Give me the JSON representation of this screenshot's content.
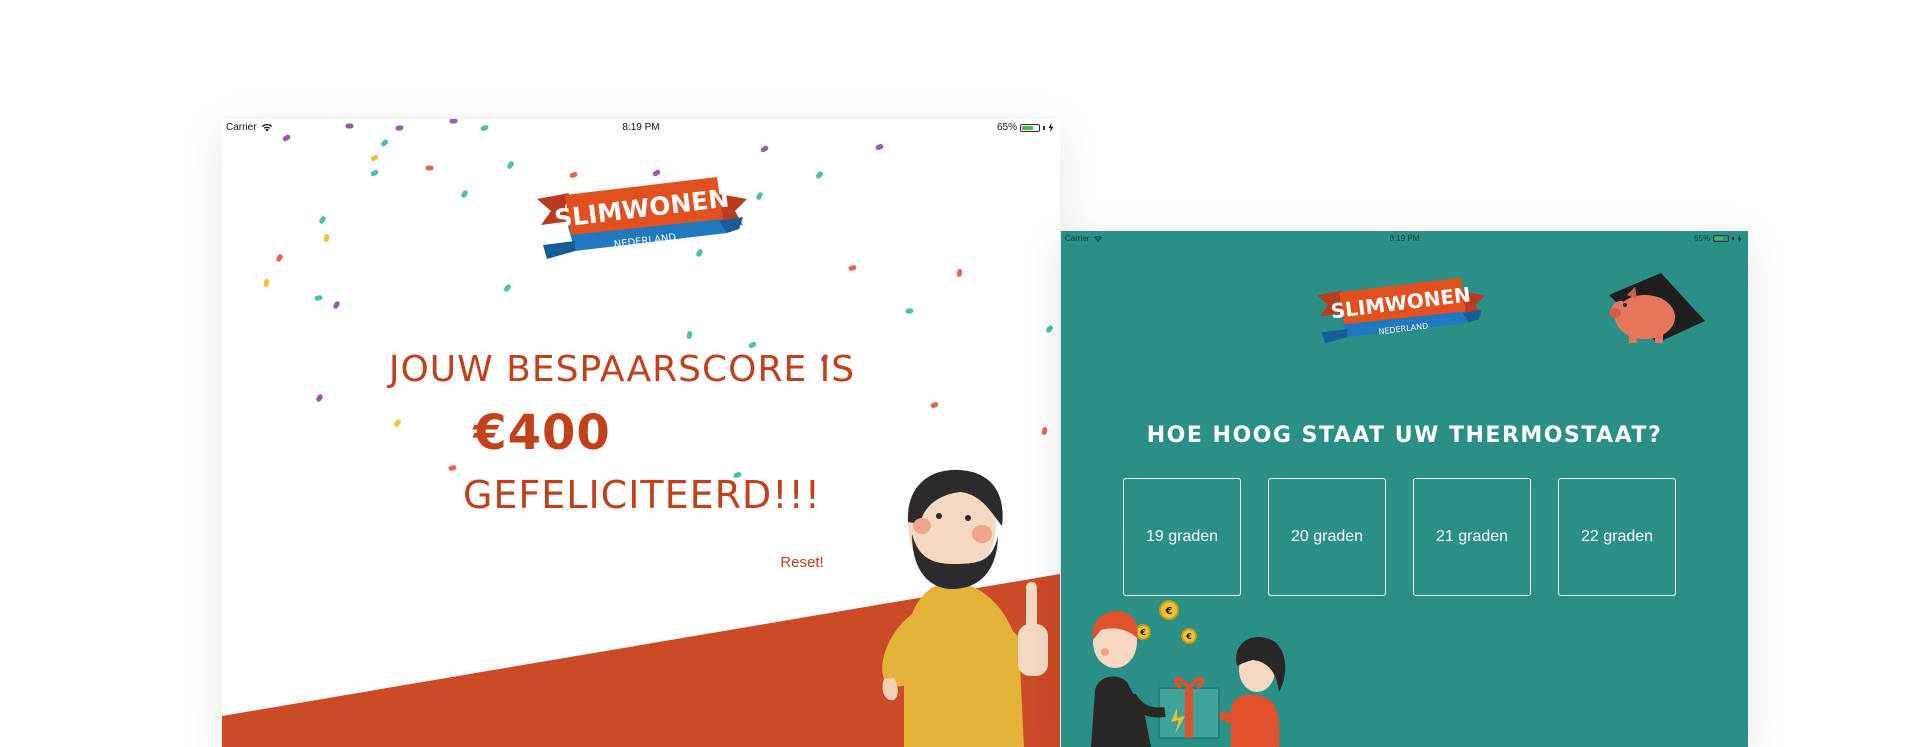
{
  "left_screen": {
    "status_bar": {
      "carrier": "Carrier",
      "time": "8:19 PM",
      "battery": "65%"
    },
    "logo": {
      "main": "SLIMWONEN",
      "sub": "NEDERLAND"
    },
    "score": {
      "heading": "JOUW BESPAARSCORE IS",
      "amount": "€400",
      "congrats": "GEFELICITEERD!!!"
    },
    "reset_label": "Reset!",
    "colors": {
      "accent": "#c0411c",
      "band": "#cd4a26"
    }
  },
  "right_screen": {
    "status_bar": {
      "carrier": "Carrier",
      "time": "8:19 PM",
      "battery": "65%"
    },
    "logo": {
      "main": "SLIMWONEN",
      "sub": "NEDERLAND"
    },
    "question": "HOE HOOG STAAT UW THERMOSTAAT?",
    "answers": [
      "19 graden",
      "20 graden",
      "21 graden",
      "22 graden"
    ],
    "colors": {
      "background": "#2a8f87"
    }
  }
}
